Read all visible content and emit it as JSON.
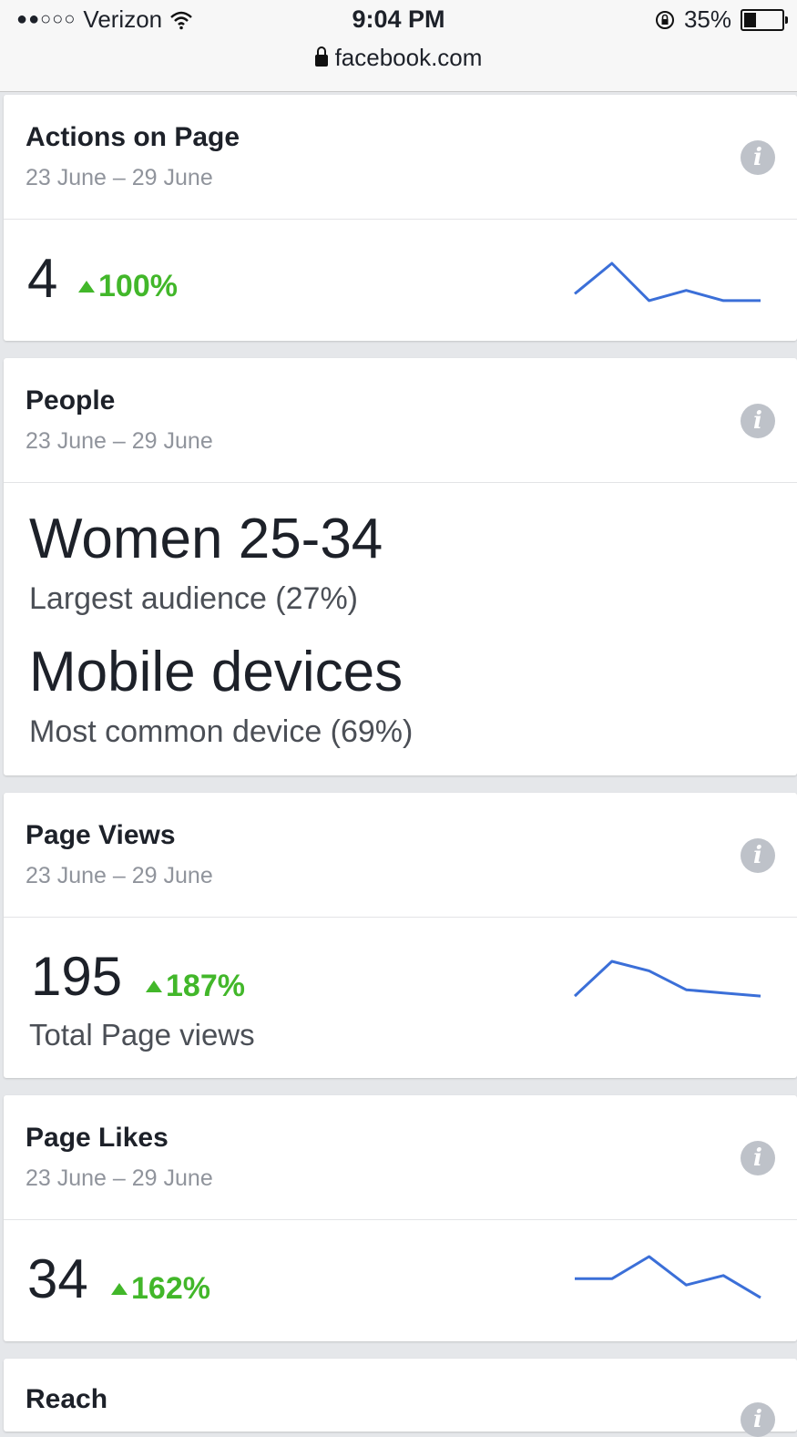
{
  "status_bar": {
    "carrier": "Verizon",
    "time": "9:04 PM",
    "battery": "35%",
    "battery_level": 0.35,
    "url": "facebook.com"
  },
  "cards": {
    "actions": {
      "title": "Actions on Page",
      "date_range": "23 June – 29 June",
      "value": "4",
      "change": "100%",
      "sparkline": [
        5,
        14,
        3,
        6,
        3,
        3
      ]
    },
    "people": {
      "title": "People",
      "date_range": "23 June – 29 June",
      "primary": "Women 25-34",
      "primary_sub": "Largest audience (27%)",
      "secondary": "Mobile devices",
      "secondary_sub": "Most common device (69%)"
    },
    "page_views": {
      "title": "Page Views",
      "date_range": "23 June – 29 June",
      "value": "195",
      "change": "187%",
      "label": "Total Page views",
      "sparkline": [
        4,
        15,
        12,
        6,
        5,
        4
      ]
    },
    "page_likes": {
      "title": "Page Likes",
      "date_range": "23 June – 29 June",
      "value": "34",
      "change": "162%",
      "sparkline": [
        8,
        8,
        15,
        6,
        9,
        2
      ]
    },
    "reach": {
      "title": "Reach"
    }
  },
  "icons": {
    "info": "info-icon",
    "wifi": "wifi-icon",
    "lock": "lock-icon",
    "orientation_lock": "orientation-lock-icon"
  },
  "colors": {
    "accent_green": "#42b72a",
    "sparkline_blue": "#3b6fd8"
  }
}
